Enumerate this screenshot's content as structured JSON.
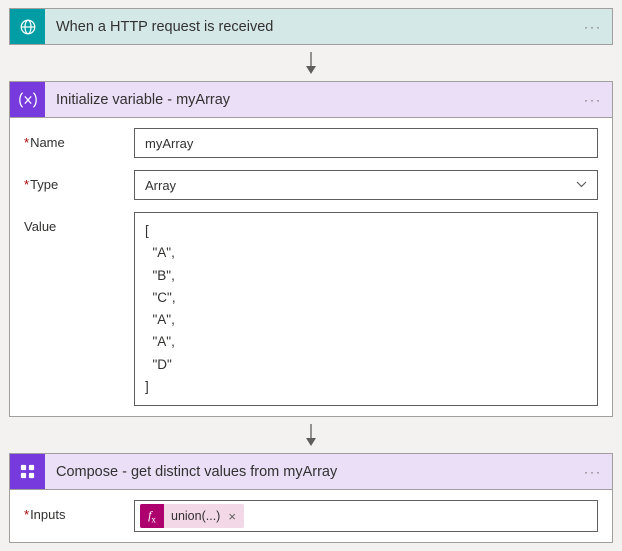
{
  "trigger": {
    "title": "When a HTTP request is received",
    "menu": "···"
  },
  "initvar": {
    "title": "Initialize variable - myArray",
    "menu": "···",
    "name_label": "Name",
    "name_value": "myArray",
    "type_label": "Type",
    "type_value": "Array",
    "value_label": "Value",
    "value_content": "[\n  \"A\",\n  \"B\",\n  \"C\",\n  \"A\",\n  \"A\",\n  \"D\"\n]"
  },
  "compose": {
    "title": "Compose - get distinct values from myArray",
    "menu": "···",
    "inputs_label": "Inputs",
    "expr_text": "union(...)"
  }
}
